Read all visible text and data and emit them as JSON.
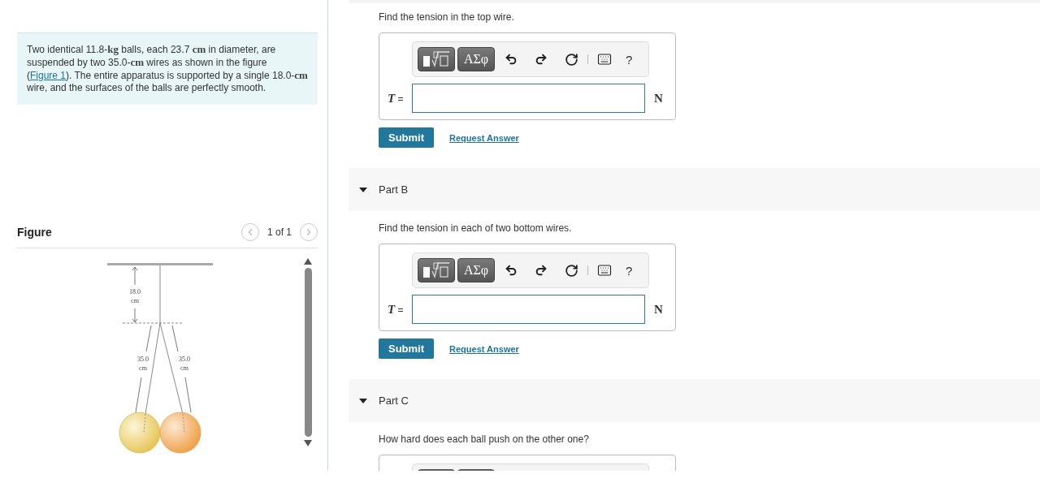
{
  "problem": {
    "segments": [
      {
        "kind": "plain",
        "text": "Two identical 11.8-"
      },
      {
        "kind": "unit",
        "text": "kg"
      },
      {
        "kind": "plain",
        "text": " balls, each 23.7 "
      },
      {
        "kind": "unit",
        "text": "cm"
      },
      {
        "kind": "plain",
        "text": " in diameter, are suspended by two 35.0-"
      },
      {
        "kind": "unit",
        "text": "cm"
      },
      {
        "kind": "plain",
        "text": " wires as shown in the figure ("
      },
      {
        "kind": "link",
        "text": "Figure 1"
      },
      {
        "kind": "plain",
        "text": "). The entire apparatus is supported by a single 18.0-"
      },
      {
        "kind": "unit",
        "text": "cm"
      },
      {
        "kind": "plain",
        "text": " wire, and the surfaces of the balls are perfectly smooth."
      }
    ]
  },
  "figure": {
    "title": "Figure",
    "pager": "1 of 1",
    "labels": [
      {
        "value": "18.0",
        "unit": "cm"
      },
      {
        "value": "35.0",
        "unit": "cm"
      },
      {
        "value": "35.0",
        "unit": "cm"
      }
    ]
  },
  "parts": [
    {
      "prompt": "Find the tension in the top wire.",
      "answer": {
        "symbols": "ΑΣφ",
        "help": "?",
        "variable": "T",
        "equals": "=",
        "unit": "N"
      },
      "submit": "Submit",
      "request": "Request Answer"
    },
    {
      "label": "Part B",
      "expanded": true,
      "prompt": "Find the tension in each of two bottom wires.",
      "answer": {
        "symbols": "ΑΣφ",
        "help": "?",
        "variable": "T",
        "equals": "=",
        "unit": "N"
      },
      "submit": "Submit",
      "request": "Request Answer"
    },
    {
      "label": "Part C",
      "expanded": true,
      "prompt": "How hard does each ball push on the other one?",
      "answer": {
        "cut": true
      }
    }
  ]
}
